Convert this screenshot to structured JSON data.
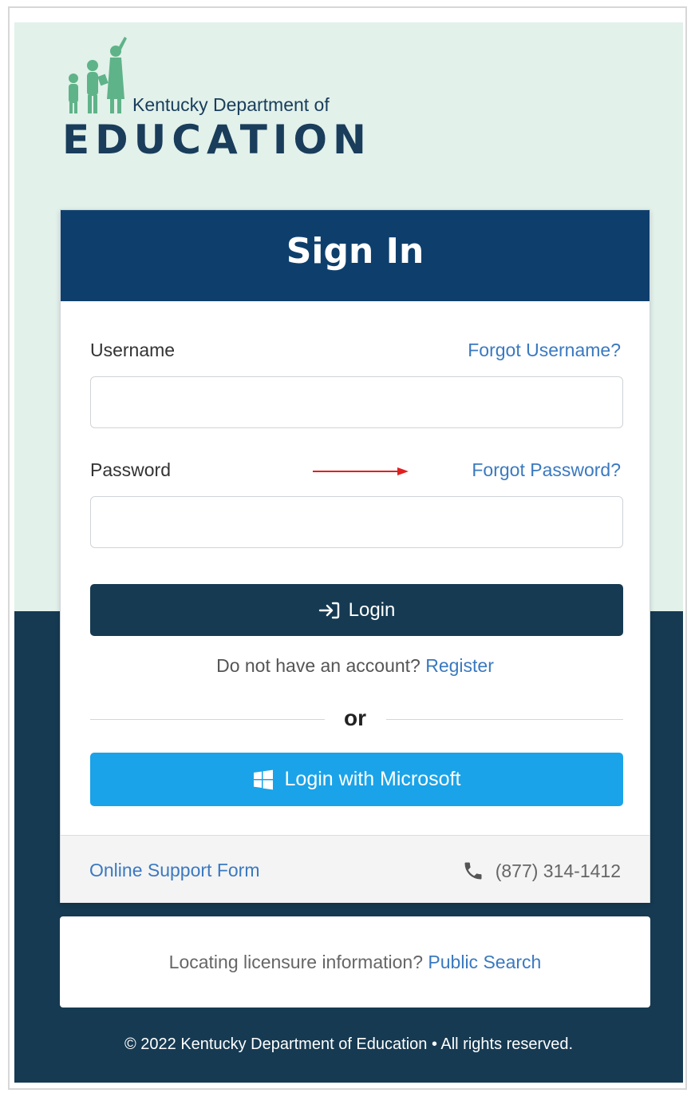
{
  "logo": {
    "line1": "Kentucky Department of",
    "line2": "EDUCATION"
  },
  "signin": {
    "title": "Sign In",
    "username_label": "Username",
    "forgot_username": "Forgot Username?",
    "password_label": "Password",
    "forgot_password": "Forgot Password?",
    "login_button": "Login",
    "no_account": "Do not have an account?",
    "register": "Register",
    "or": "or",
    "microsoft_button": "Login with Microsoft",
    "support_link": "Online Support Form",
    "phone": "(877) 314-1412"
  },
  "public": {
    "question": "Locating licensure information?",
    "link": "Public Search"
  },
  "footer": {
    "copyright": "© 2022 Kentucky Department of Education • All rights reserved."
  },
  "colors": {
    "header": "#0e3f6c",
    "dark": "#163a52",
    "link": "#3a79c0",
    "microsoft": "#1aa3e8",
    "logo_green": "#5fb389",
    "annotation_arrow": "#e02020"
  },
  "icons": [
    "login-icon",
    "windows-icon",
    "phone-icon",
    "annotation-arrow"
  ]
}
